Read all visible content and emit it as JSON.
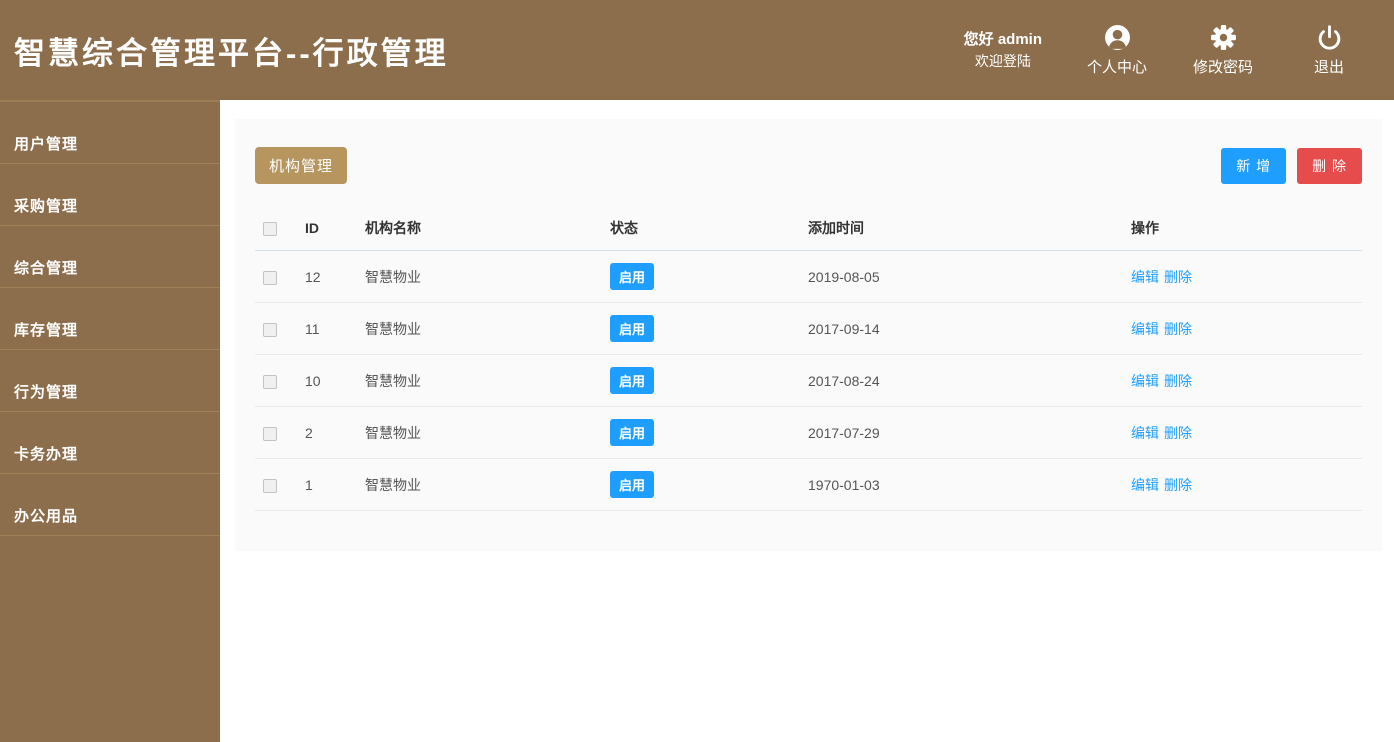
{
  "header": {
    "title": "智慧综合管理平台--行政管理",
    "greeting_line1": "您好 admin",
    "greeting_line2": "欢迎登陆",
    "actions": [
      {
        "icon": "user-icon",
        "label": "个人中心"
      },
      {
        "icon": "gear-icon",
        "label": "修改密码"
      },
      {
        "icon": "power-icon",
        "label": "退出"
      }
    ]
  },
  "sidebar": {
    "items": [
      {
        "label": "用户管理"
      },
      {
        "label": "采购管理"
      },
      {
        "label": "综合管理"
      },
      {
        "label": "库存管理"
      },
      {
        "label": "行为管理"
      },
      {
        "label": "卡务办理"
      },
      {
        "label": "办公用品"
      }
    ]
  },
  "main": {
    "tab_label": "机构管理",
    "add_button": "新 增",
    "delete_button": "删 除",
    "table": {
      "columns": [
        "ID",
        "机构名称",
        "状态",
        "添加时间",
        "操作"
      ],
      "rows": [
        {
          "id": "12",
          "name": "智慧物业",
          "status": "启用",
          "date": "2019-08-05",
          "edit": "编辑",
          "del": "删除"
        },
        {
          "id": "11",
          "name": "智慧物业",
          "status": "启用",
          "date": "2017-09-14",
          "edit": "编辑",
          "del": "删除"
        },
        {
          "id": "10",
          "name": "智慧物业",
          "status": "启用",
          "date": "2017-08-24",
          "edit": "编辑",
          "del": "删除"
        },
        {
          "id": "2",
          "name": "智慧物业",
          "status": "启用",
          "date": "2017-07-29",
          "edit": "编辑",
          "del": "删除"
        },
        {
          "id": "1",
          "name": "智慧物业",
          "status": "启用",
          "date": "1970-01-03",
          "edit": "编辑",
          "del": "删除"
        }
      ]
    }
  },
  "colors": {
    "brand_brown": "#8d6e4c",
    "tag_tan": "#b6955e",
    "accent_blue": "#1e9fff",
    "danger_red": "#e64c4c"
  }
}
